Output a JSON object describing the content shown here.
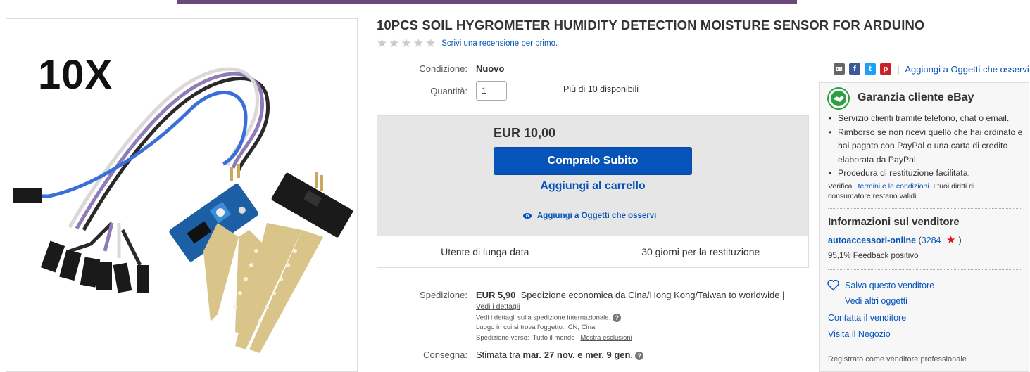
{
  "product": {
    "title": "10PCS SOIL HYGROMETER HUMIDITY DETECTION MOISTURE SENSOR FOR ARDUINO",
    "image_overlay": "10X",
    "review_link": "Scrivi una recensione per primo."
  },
  "details": {
    "condition_label": "Condizione:",
    "condition_value": "Nuovo",
    "quantity_label": "Quantità:",
    "quantity_value": "1",
    "availability": "Più di 10 disponibili"
  },
  "buy": {
    "price": "EUR 10,00",
    "buy_now": "Compralo Subito",
    "add_to_cart": "Aggiungi al carrello",
    "watch": "Aggiungi a Oggetti che osservi",
    "badge_1": "Utente di lunga data",
    "badge_2": "30 giorni per la restituzione"
  },
  "shipping": {
    "label": "Spedizione:",
    "cost": "EUR 5,90",
    "method": "Spedizione economica da Cina/Hong Kong/Taiwan to worldwide |",
    "details_link": "Vedi i dettagli",
    "note": "Vedi i dettagli sulla spedizione internazionale.",
    "location_label": "Luogo in cui si trova l'oggetto:",
    "location": "CN, Cina",
    "ship_to_label": "Spedizione verso:",
    "ship_to": "Tutto il mondo",
    "exclusions": "Mostra esclusioni"
  },
  "delivery": {
    "label": "Consegna:",
    "prefix": "Stimata tra",
    "range": "mar. 27 nov. e mer. 9 gen."
  },
  "share": {
    "watch_link": "Aggiungi a Oggetti che osservi",
    "separator": "|"
  },
  "guarantee": {
    "title": "Garanzia cliente eBay",
    "items": [
      "Servizio clienti tramite telefono, chat o email.",
      "Rimborso se non ricevi quello che hai ordinato e hai pagato con PayPal o una carta di credito elaborata da PayPal.",
      "Procedura di restituzione facilitata."
    ],
    "verify_prefix": "Verifica i",
    "verify_link": "termini e le condizioni",
    "verify_suffix": ". I tuoi diritti di consumatore restano validi."
  },
  "seller": {
    "title": "Informazioni sul venditore",
    "name": "autoaccessori-online",
    "score_open": "(",
    "score": "3284",
    "score_close": ")",
    "feedback": "95,1% Feedback positivo",
    "save": "Salva questo venditore",
    "other_items": "Vedi altri oggetti",
    "contact": "Contatta il venditore",
    "store": "Visita il Negozio",
    "registered": "Registrato come venditore professionale"
  },
  "colors": {
    "link": "#0654ba",
    "buy_button": "#0654ba",
    "buy_box_bg": "#e6e6e6",
    "star_empty": "#cccccc",
    "seller_star": "#e0101e"
  }
}
